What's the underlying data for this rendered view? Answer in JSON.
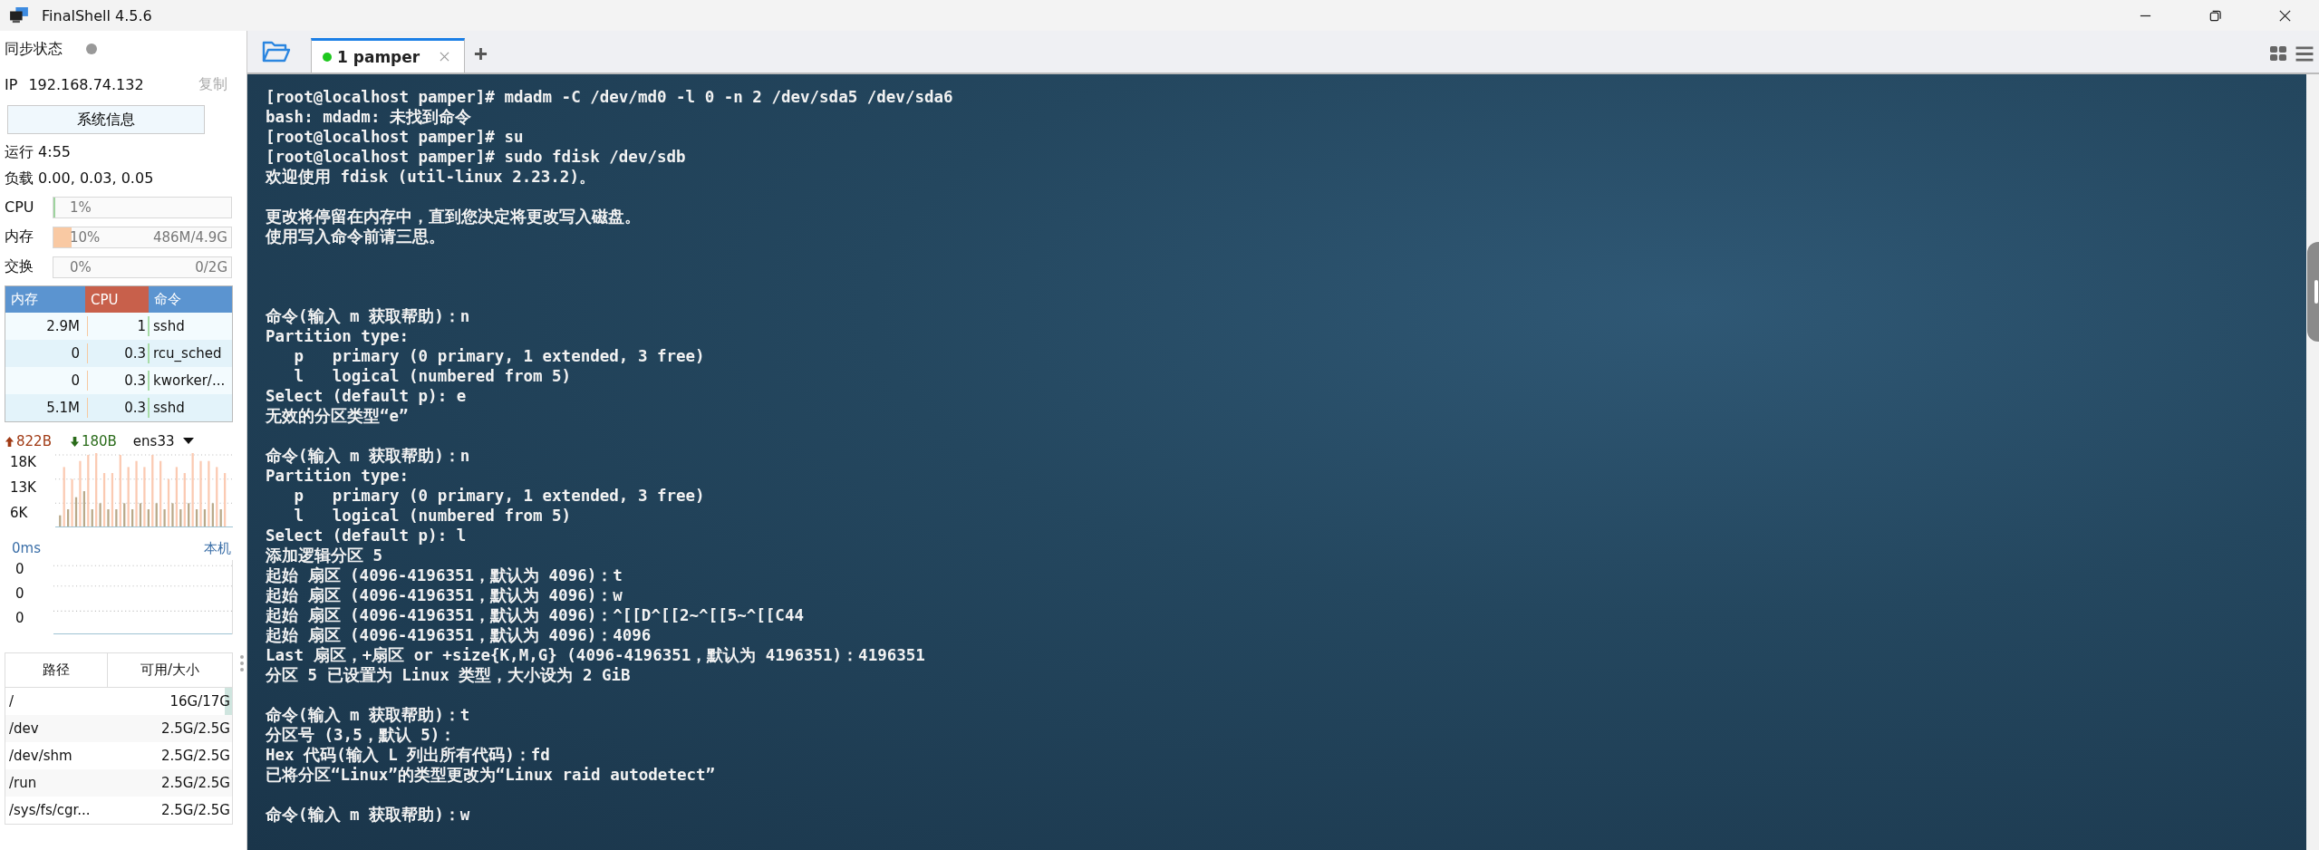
{
  "window": {
    "title": "FinalShell 4.5.6"
  },
  "sidebar": {
    "sync": {
      "label": "同步状态",
      "on": false
    },
    "ip": {
      "label": "IP",
      "value": "192.168.74.132",
      "copy": "复制"
    },
    "sysinfo_button": "系统信息",
    "uptime": "运行 4:55",
    "load": "负载 0.00, 0.03, 0.05",
    "meters": [
      {
        "label": "CPU",
        "percent": "1%",
        "level": 0.01,
        "color": "#9fd49f"
      },
      {
        "label": "内存",
        "percent": "10%",
        "detail": "486M/4.9G",
        "level": 0.1,
        "color": "#f9c9a3"
      },
      {
        "label": "交换",
        "percent": "0%",
        "detail": "0/2G"
      }
    ],
    "processes": {
      "columns": [
        {
          "label": "内存",
          "sorted": false
        },
        {
          "label": "CPU",
          "sorted": true
        },
        {
          "label": "命令",
          "sorted": false
        }
      ],
      "rows": [
        [
          "2.9M",
          "1",
          "sshd"
        ],
        [
          "0",
          "0.3",
          "rcu_sched"
        ],
        [
          "0",
          "0.3",
          "kworker/..."
        ],
        [
          "5.1M",
          "0.3",
          "sshd"
        ]
      ]
    },
    "network": {
      "upload": "822B",
      "download": "180B",
      "interface": "ens33",
      "yticks": [
        "18K",
        "13K",
        "6K"
      ]
    },
    "latency": {
      "value": "0ms",
      "host": "本机",
      "yticks": [
        "0",
        "0",
        "0"
      ]
    },
    "disks": {
      "columns": [
        "路径",
        "可用/大小"
      ],
      "rows": [
        {
          "path": "/",
          "size": "16G/17G",
          "level": 0.06
        },
        {
          "path": "/dev",
          "size": "2.5G/2.5G"
        },
        {
          "path": "/dev/shm",
          "size": "2.5G/2.5G"
        },
        {
          "path": "/run",
          "size": "2.5G/2.5G"
        },
        {
          "path": "/sys/fs/cgr...",
          "size": "2.5G/2.5G"
        }
      ]
    }
  },
  "tabs": [
    {
      "label": "1 pamper",
      "selected": true,
      "connected": true
    }
  ],
  "terminal": {
    "lines": [
      {
        "text": "[root@localhost pamper]# mdadm -C /dev/md0 -l 0 -n 2 /dev/sda5 /dev/sda6"
      },
      {
        "text": "bash: mdadm: 未找到命令"
      },
      {
        "text": "[root@localhost pamper]# su"
      },
      {
        "text": "[root@localhost pamper]# sudo fdisk /dev/sdb"
      },
      {
        "text": "欢迎使用 fdisk (util-linux 2.23.2)。"
      },
      {
        "kind": "blank"
      },
      {
        "text": "更改将停留在内存中，直到您决定将更改写入磁盘。"
      },
      {
        "text": "使用写入命令前请三思。"
      },
      {
        "kind": "blank"
      },
      {
        "kind": "blank"
      },
      {
        "kind": "blank"
      },
      {
        "text": "命令(输入 m 获取帮助)：n"
      },
      {
        "text": "Partition type:"
      },
      {
        "text": "   p   primary (0 primary, 1 extended, 3 free)"
      },
      {
        "text": "   l   logical (numbered from 5)"
      },
      {
        "text": "Select (default p): e"
      },
      {
        "text": "无效的分区类型“e”"
      },
      {
        "kind": "blank"
      },
      {
        "text": "命令(输入 m 获取帮助)：n"
      },
      {
        "text": "Partition type:"
      },
      {
        "text": "   p   primary (0 primary, 1 extended, 3 free)"
      },
      {
        "text": "   l   logical (numbered from 5)"
      },
      {
        "text": "Select (default p): l"
      },
      {
        "text": "添加逻辑分区 5"
      },
      {
        "text": "起始 扇区 (4096-4196351，默认为 4096)：t"
      },
      {
        "text": "起始 扇区 (4096-4196351，默认为 4096)：w"
      },
      {
        "text": "起始 扇区 (4096-4196351，默认为 4096)：^[[D^[[2~^[[5~^[[C44"
      },
      {
        "text": "起始 扇区 (4096-4196351，默认为 4096)：4096"
      },
      {
        "text": "Last 扇区，+扇区 or +size{K,M,G} (4096-4196351，默认为 4196351)：4196351"
      },
      {
        "text": "分区 5 已设置为 Linux 类型，大小设为 2 GiB"
      },
      {
        "kind": "blank"
      },
      {
        "text": "命令(输入 m 获取帮助)：t"
      },
      {
        "text": "分区号 (3,5，默认 5)："
      },
      {
        "text": "Hex 代码(输入 L 列出所有代码)：fd"
      },
      {
        "text": "已将分区“Linux”的类型更改为“Linux raid autodetect”"
      },
      {
        "kind": "blank"
      },
      {
        "text": "命令(输入 m 获取帮助)：w"
      }
    ]
  }
}
